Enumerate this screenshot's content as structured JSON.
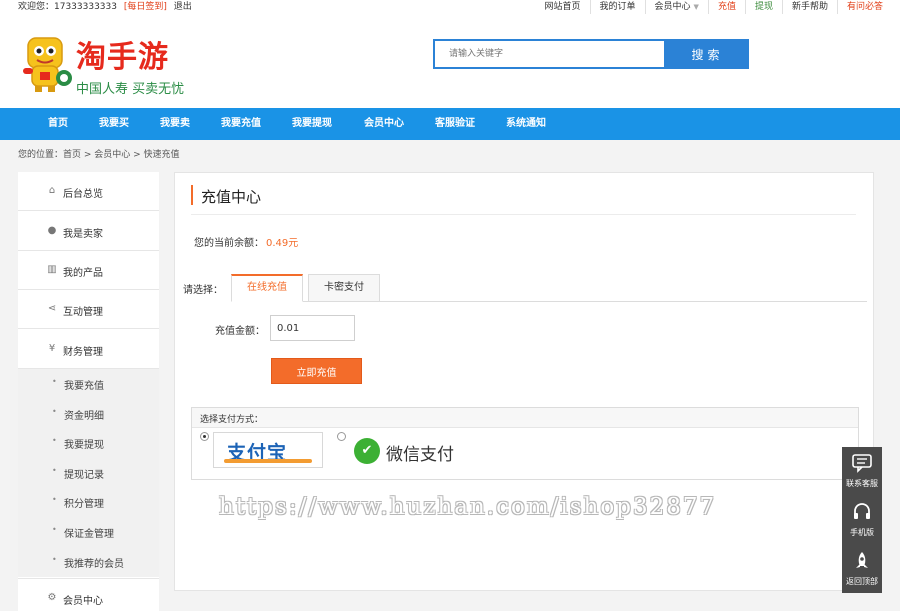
{
  "topbar": {
    "welcome": "欢迎您：17333333333",
    "sign_in": "[每日签到]",
    "logout": "退出",
    "links": [
      "网站首页",
      "我的订单",
      "会员中心",
      "充值",
      "提现",
      "新手帮助",
      "有问必答"
    ]
  },
  "header": {
    "brand": "淘手游",
    "slogan": "中国人寿 买卖无忧",
    "search_placeholder": "请输入关键字",
    "search_button": "搜索"
  },
  "nav": [
    "首页",
    "我要买",
    "我要卖",
    "我要充值",
    "我要提现",
    "会员中心",
    "客服验证",
    "系统通知"
  ],
  "breadcrumb": "您的位置：首页 > 会员中心 > 快速充值",
  "sidebar": {
    "items": [
      {
        "label": "后台总览",
        "icon": "home-icon"
      },
      {
        "label": "我是卖家",
        "icon": "user-icon"
      },
      {
        "label": "我的产品",
        "icon": "barcode-icon"
      },
      {
        "label": "互动管理",
        "icon": "share-icon"
      },
      {
        "label": "财务管理",
        "icon": "yen-icon"
      }
    ],
    "sub_items": [
      "我要充值",
      "资金明细",
      "我要提现",
      "提现记录",
      "积分管理",
      "保证金管理",
      "我推荐的会员"
    ],
    "last_item": {
      "label": "会员中心",
      "icon": "gears-icon"
    }
  },
  "main": {
    "title": "充值中心",
    "balance_label": "您的当前余额：",
    "balance_value": "0.49元",
    "tabs_label": "请选择：",
    "tabs": [
      "在线充值",
      "卡密支付"
    ],
    "amount_label": "充值金额：",
    "amount_value": "0.01",
    "submit": "立即充值",
    "payment_header": "选择支付方式：",
    "alipay_label": "支付宝",
    "wechat_label": "微信支付"
  },
  "watermark": "https://www.huzhan.com/ishop32877",
  "float_bar": [
    "联系客服",
    "手机版",
    "返回顶部"
  ],
  "colors": {
    "accent": "#1a93e6",
    "orange": "#f36c2a",
    "brand_red": "#e62a1d"
  }
}
